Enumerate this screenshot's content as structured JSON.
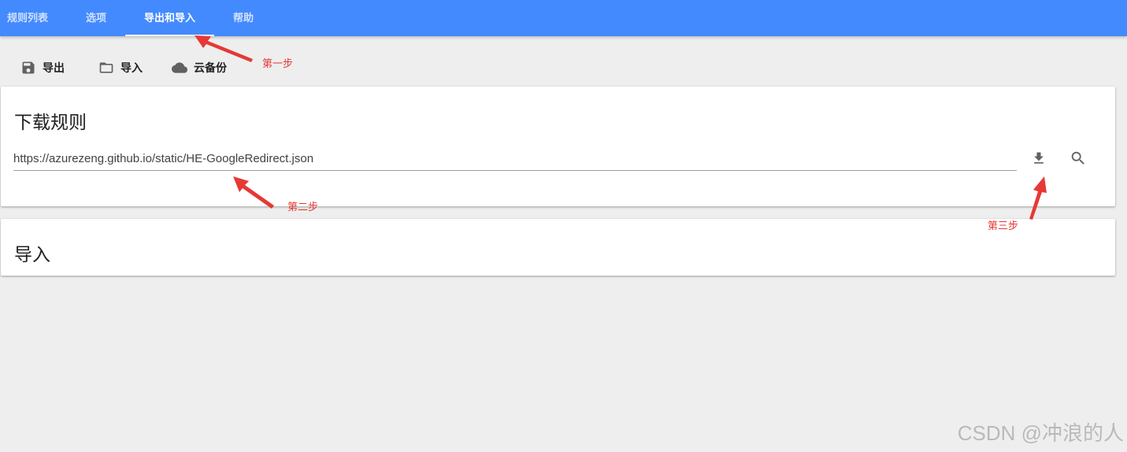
{
  "tabs": [
    {
      "label": "规则列表"
    },
    {
      "label": "选项"
    },
    {
      "label": "导出和导入",
      "active": true
    },
    {
      "label": "帮助"
    }
  ],
  "toolbar": {
    "export_label": "导出",
    "import_label": "导入",
    "cloud_backup_label": "云备份"
  },
  "download_card": {
    "title": "下载规则",
    "url_value": "https://azurezeng.github.io/static/HE-GoogleRedirect.json",
    "download_icon": "download-icon",
    "search_icon": "search-icon"
  },
  "import_card": {
    "title": "导入"
  },
  "annotations": {
    "step1": "第一步",
    "step2": "第二步",
    "step3": "第三步",
    "color": "#e53935"
  },
  "watermark": "CSDN @冲浪的人",
  "colors": {
    "tabbar": "#448aff",
    "background": "#eeeeee",
    "card": "#ffffff"
  }
}
